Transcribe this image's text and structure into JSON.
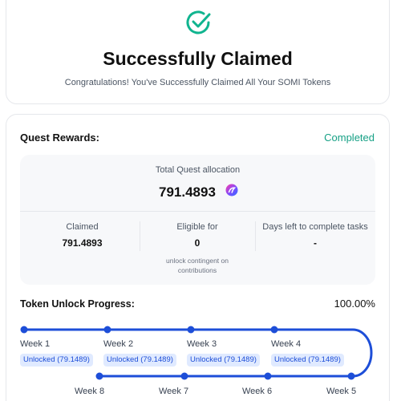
{
  "header": {
    "title": "Successfully Claimed",
    "subtitle": "Congratulations! You've Successfully Claimed All Your SOMI Tokens",
    "icon": "check-circle-icon",
    "accent_color": "#10b48f"
  },
  "quest": {
    "label": "Quest Rewards:",
    "status": "Completed",
    "status_color": "#16a085",
    "allocation_label": "Total Quest allocation",
    "allocation_value": "791.4893",
    "token_icon": "somi-token-icon"
  },
  "stats": {
    "claimed_label": "Claimed",
    "claimed_value": "791.4893",
    "eligible_label": "Eligible for",
    "eligible_value": "0",
    "eligible_note": "unlock contingent on contributions",
    "days_label": "Days left to complete tasks",
    "days_value": "-"
  },
  "progress": {
    "label": "Token Unlock Progress:",
    "value": "100.00%",
    "accent_color": "#1d4ed8",
    "weeks_top": [
      {
        "label": "Week 1",
        "badge": "Unlocked (79.1489)"
      },
      {
        "label": "Week 2",
        "badge": "Unlocked (79.1489)"
      },
      {
        "label": "Week 3",
        "badge": "Unlocked (79.1489)"
      },
      {
        "label": "Week 4",
        "badge": "Unlocked (79.1489)"
      }
    ],
    "weeks_bottom": [
      {
        "label": "Week 8"
      },
      {
        "label": "Week 7"
      },
      {
        "label": "Week 6"
      },
      {
        "label": "Week 5"
      }
    ]
  }
}
